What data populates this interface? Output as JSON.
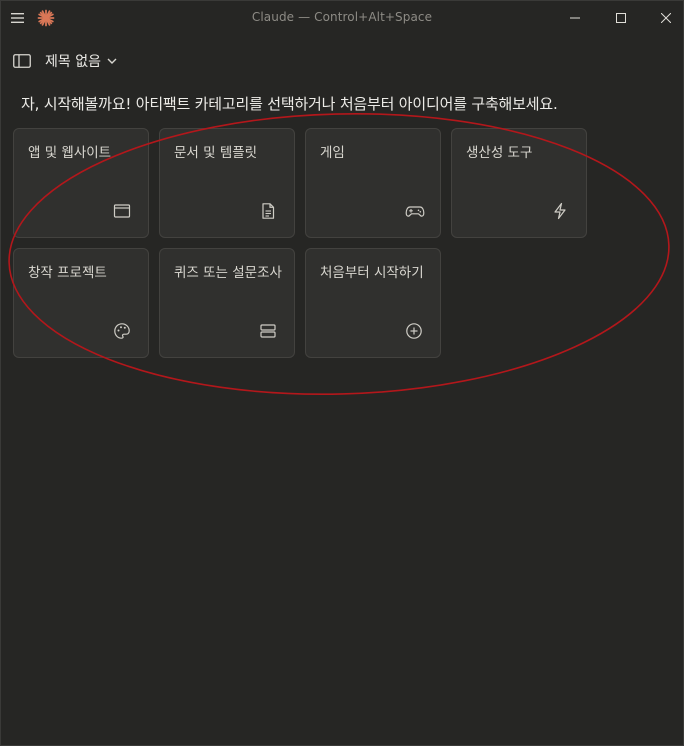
{
  "window": {
    "title": "Claude — Control+Alt+Space"
  },
  "header": {
    "chat_title": "제목 없음"
  },
  "prompt": "자, 시작해볼까요! 아티팩트 카테고리를 선택하거나 처음부터 아이디어를 구축해보세요.",
  "categories": [
    {
      "label": "앱 및 웹사이트",
      "icon": "browser-window-icon"
    },
    {
      "label": "문서 및 템플릿",
      "icon": "document-icon"
    },
    {
      "label": "게임",
      "icon": "gamepad-icon"
    },
    {
      "label": "생산성 도구",
      "icon": "lightning-icon"
    },
    {
      "label": "창작 프로젝트",
      "icon": "palette-icon"
    },
    {
      "label": "퀴즈 또는 설문조사",
      "icon": "stacked-rows-icon"
    },
    {
      "label": "처음부터 시작하기",
      "icon": "plus-circle-icon"
    }
  ],
  "colors": {
    "background": "#262624",
    "card": "#30302e",
    "card_border": "#43423f",
    "accent": "#d97757",
    "annotation": "#b3171b"
  }
}
